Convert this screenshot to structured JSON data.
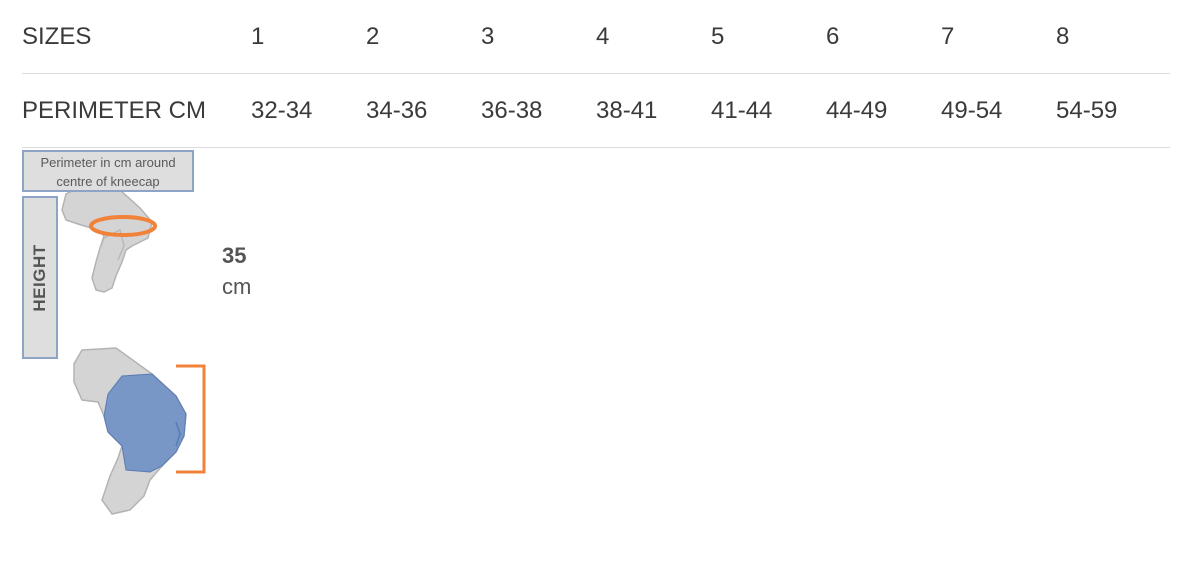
{
  "table": {
    "rows": [
      {
        "label": "SIZES",
        "cells": [
          "1",
          "2",
          "3",
          "4",
          "5",
          "6",
          "7",
          "8"
        ]
      },
      {
        "label": "PERIMETER CM",
        "cells": [
          "32-34",
          "34-36",
          "36-38",
          "38-41",
          "41-44",
          "44-49",
          "49-54",
          "54-59"
        ]
      }
    ]
  },
  "diagram": {
    "perimeter_caption_line1": "Perimeter in cm around",
    "perimeter_caption_line2": "centre of kneecap",
    "height_label": "HEIGHT",
    "height_value": "35",
    "height_unit": "cm"
  },
  "colors": {
    "perimeter_ring": "#f0823a",
    "brace": "#6e8fc4",
    "box_border": "#8ea4c7",
    "leg": "#d4d4d4"
  }
}
